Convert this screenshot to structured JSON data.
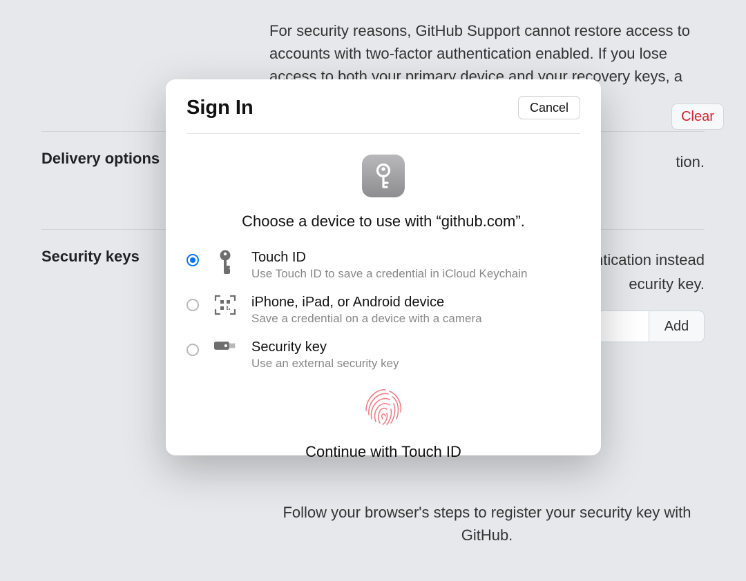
{
  "bg": {
    "paragraph": "For security reasons, GitHub Support cannot restore access to accounts with two-factor authentication enabled. If you lose access to both your primary device and your recovery keys, a backup SMS number can get you",
    "delivery_label": "Delivery options",
    "delivery_text_tail": "tion.",
    "security_label": "Security keys",
    "security_text_tail_1": "hentication instead",
    "security_text_tail_2": "ecurity key.",
    "clear": "Clear",
    "add": "Add",
    "follow": "Follow your browser's steps to register your security key with GitHub."
  },
  "modal": {
    "title": "Sign In",
    "cancel": "Cancel",
    "prompt": "Choose a device to use with “github.com”.",
    "options": [
      {
        "title": "Touch ID",
        "desc": "Use Touch ID to save a credential in iCloud Keychain"
      },
      {
        "title": "iPhone, iPad, or Android device",
        "desc": "Save a credential on a device with a camera"
      },
      {
        "title": "Security key",
        "desc": "Use an external security key"
      }
    ],
    "continue": "Continue with Touch ID"
  }
}
